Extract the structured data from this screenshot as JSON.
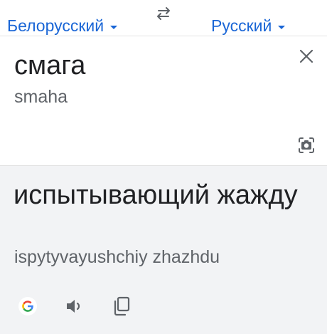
{
  "languages": {
    "source": "Белорусский",
    "target": "Русский",
    "swap_icon": "swap-arrows-icon"
  },
  "input": {
    "text": "смага",
    "transliteration": "smaha",
    "clear_icon": "close-icon",
    "camera_icon": "camera-icon"
  },
  "output": {
    "text": "испытывающий жажду",
    "transliteration": "ispytyvayushchiy zhazhdu",
    "actions": [
      "google-logo-icon",
      "speaker-icon",
      "copy-icon"
    ]
  },
  "colors": {
    "accent": "#1a66d6",
    "result_background": "#f2f3f5",
    "primary_text": "#202124",
    "secondary_text": "#5f6368"
  }
}
